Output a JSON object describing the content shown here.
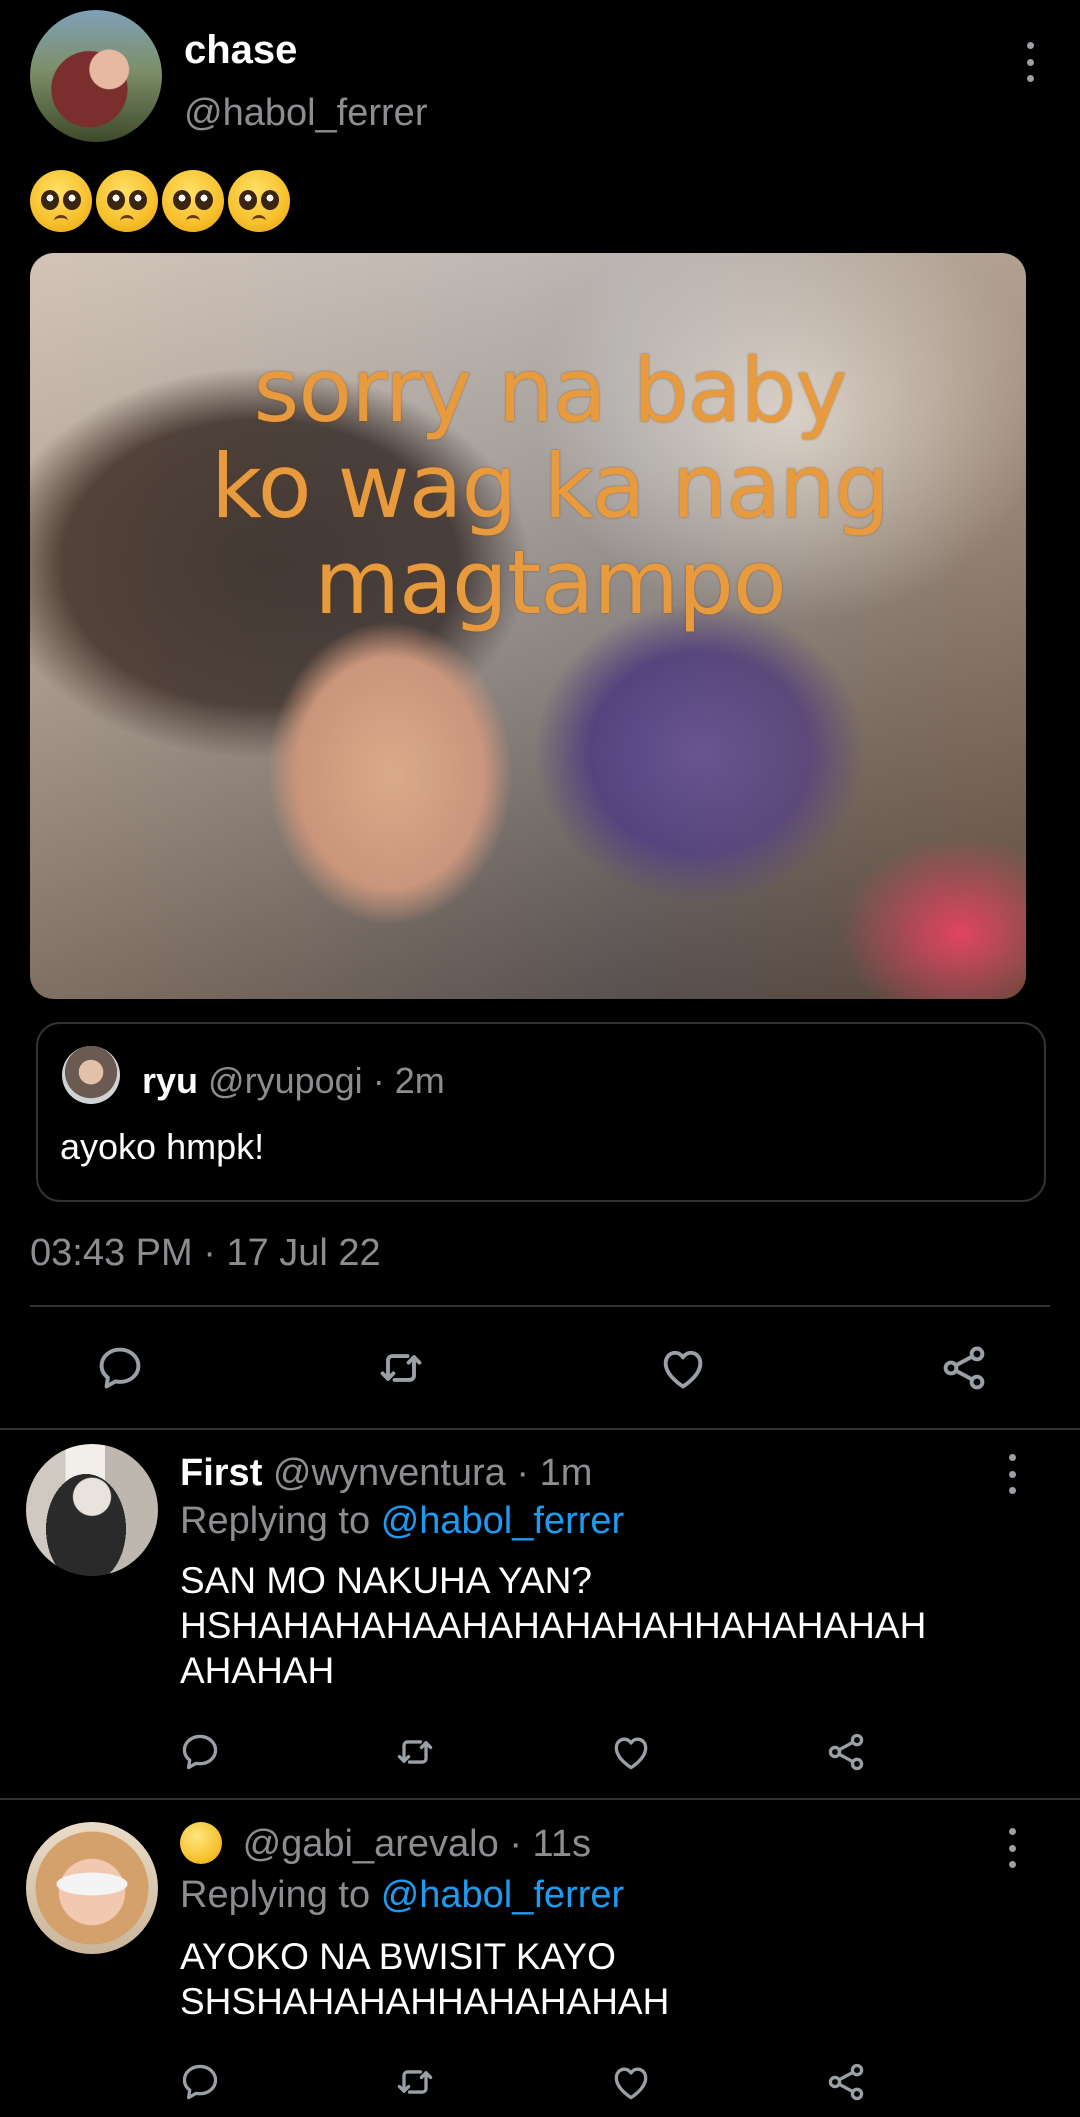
{
  "main_tweet": {
    "name": "chase",
    "handle": "@habol_ferrer",
    "text_emoji": "pleading-face x4",
    "media_caption_lines": [
      "sorry na baby",
      "ko wag ka nang",
      "magtampo"
    ],
    "quoted": {
      "name": "ryu",
      "handle": "@ryupogi",
      "separator": "·",
      "age": "2m",
      "text": "ayoko hmpk!"
    },
    "time": "03:43 PM",
    "separator": "·",
    "date": "17 Jul 22"
  },
  "replies": [
    {
      "name": "First",
      "handle": "@wynventura",
      "separator": "·",
      "age": "1m",
      "replying_prefix": "Replying to",
      "replying_handle": "@habol_ferrer",
      "text_lines": [
        "SAN MO NAKUHA YAN?",
        "HSHAHAHAHAAHAHAHAHAHHAHAHAHAH",
        "AHAHAH"
      ]
    },
    {
      "name": "",
      "handle": "@gabi_arevalo",
      "separator": "·",
      "age": "11s",
      "replying_prefix": "Replying to",
      "replying_handle": "@habol_ferrer",
      "text_lines": [
        "AYOKO NA BWISIT KAYO",
        "SHSHAHAHAHHAHAHAHAH"
      ]
    }
  ],
  "icons": {
    "reply": "speech-bubble-icon",
    "retweet": "retweet-icon",
    "like": "heart-icon",
    "share": "share-nodes-icon",
    "more": "more-vertical-icon"
  },
  "colors": {
    "background": "#000000",
    "text": "#e7e9ea",
    "muted": "#8b8d91",
    "link": "#1d9bf0",
    "divider": "#2f3336"
  }
}
